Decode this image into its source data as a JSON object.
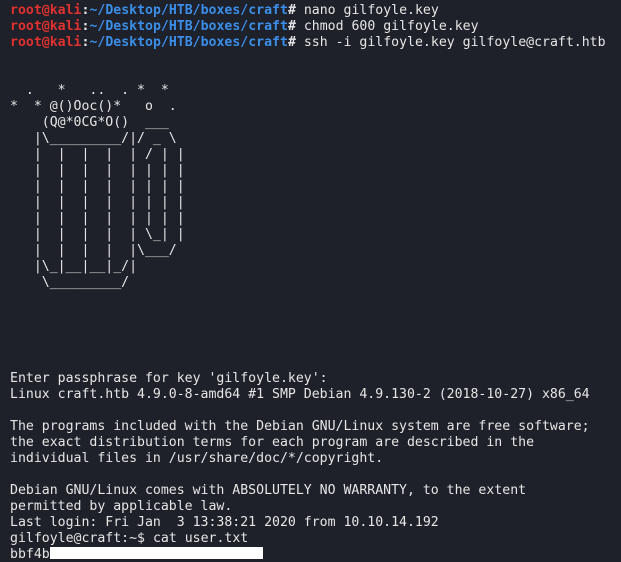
{
  "shell_prompt": {
    "user": "root",
    "at": "@",
    "host": "kali",
    "colon": ":",
    "path": "~/Desktop/HTB/boxes/craft",
    "symbol": "#"
  },
  "commands": [
    "nano gilfoyle.key",
    "chmod 600 gilfoyle.key",
    "ssh -i gilfoyle.key gilfoyle@craft.htb"
  ],
  "ascii_art": "  .   *   ..  . *  *\n*  * @()Ooc()*   o  .\n    (Q@*0CG*O()  ___\n   |\\_________/|/ _ \\\n   |  |  |  |  | / | |\n   |  |  |  |  | | | |\n   |  |  |  |  | | | |\n   |  |  |  |  | | | |\n   |  |  |  |  | | | |\n   |  |  |  |  | \\_| |\n   |  |  |  |  |\\___/\n   |\\_|__|__|_/|\n    \\_________/",
  "ssh_output": [
    "Enter passphrase for key 'gilfoyle.key':",
    "Linux craft.htb 4.9.0-8-amd64 #1 SMP Debian 4.9.130-2 (2018-10-27) x86_64",
    "",
    "The programs included with the Debian GNU/Linux system are free software;",
    "the exact distribution terms for each program are described in the",
    "individual files in /usr/share/doc/*/copyright.",
    "",
    "Debian GNU/Linux comes with ABSOLUTELY NO WARRANTY, to the extent",
    "permitted by applicable law.",
    "Last login: Fri Jan  3 13:38:21 2020 from 10.10.14.192"
  ],
  "remote_prompt": "gilfoyle@craft:~$",
  "remote_command": "cat user.txt",
  "flag_prefix": "bbf4b",
  "colors": {
    "background": "#1e2129",
    "prompt_root": "#e03131",
    "prompt_path": "#3b8eea",
    "text": "#e6e6e6"
  }
}
